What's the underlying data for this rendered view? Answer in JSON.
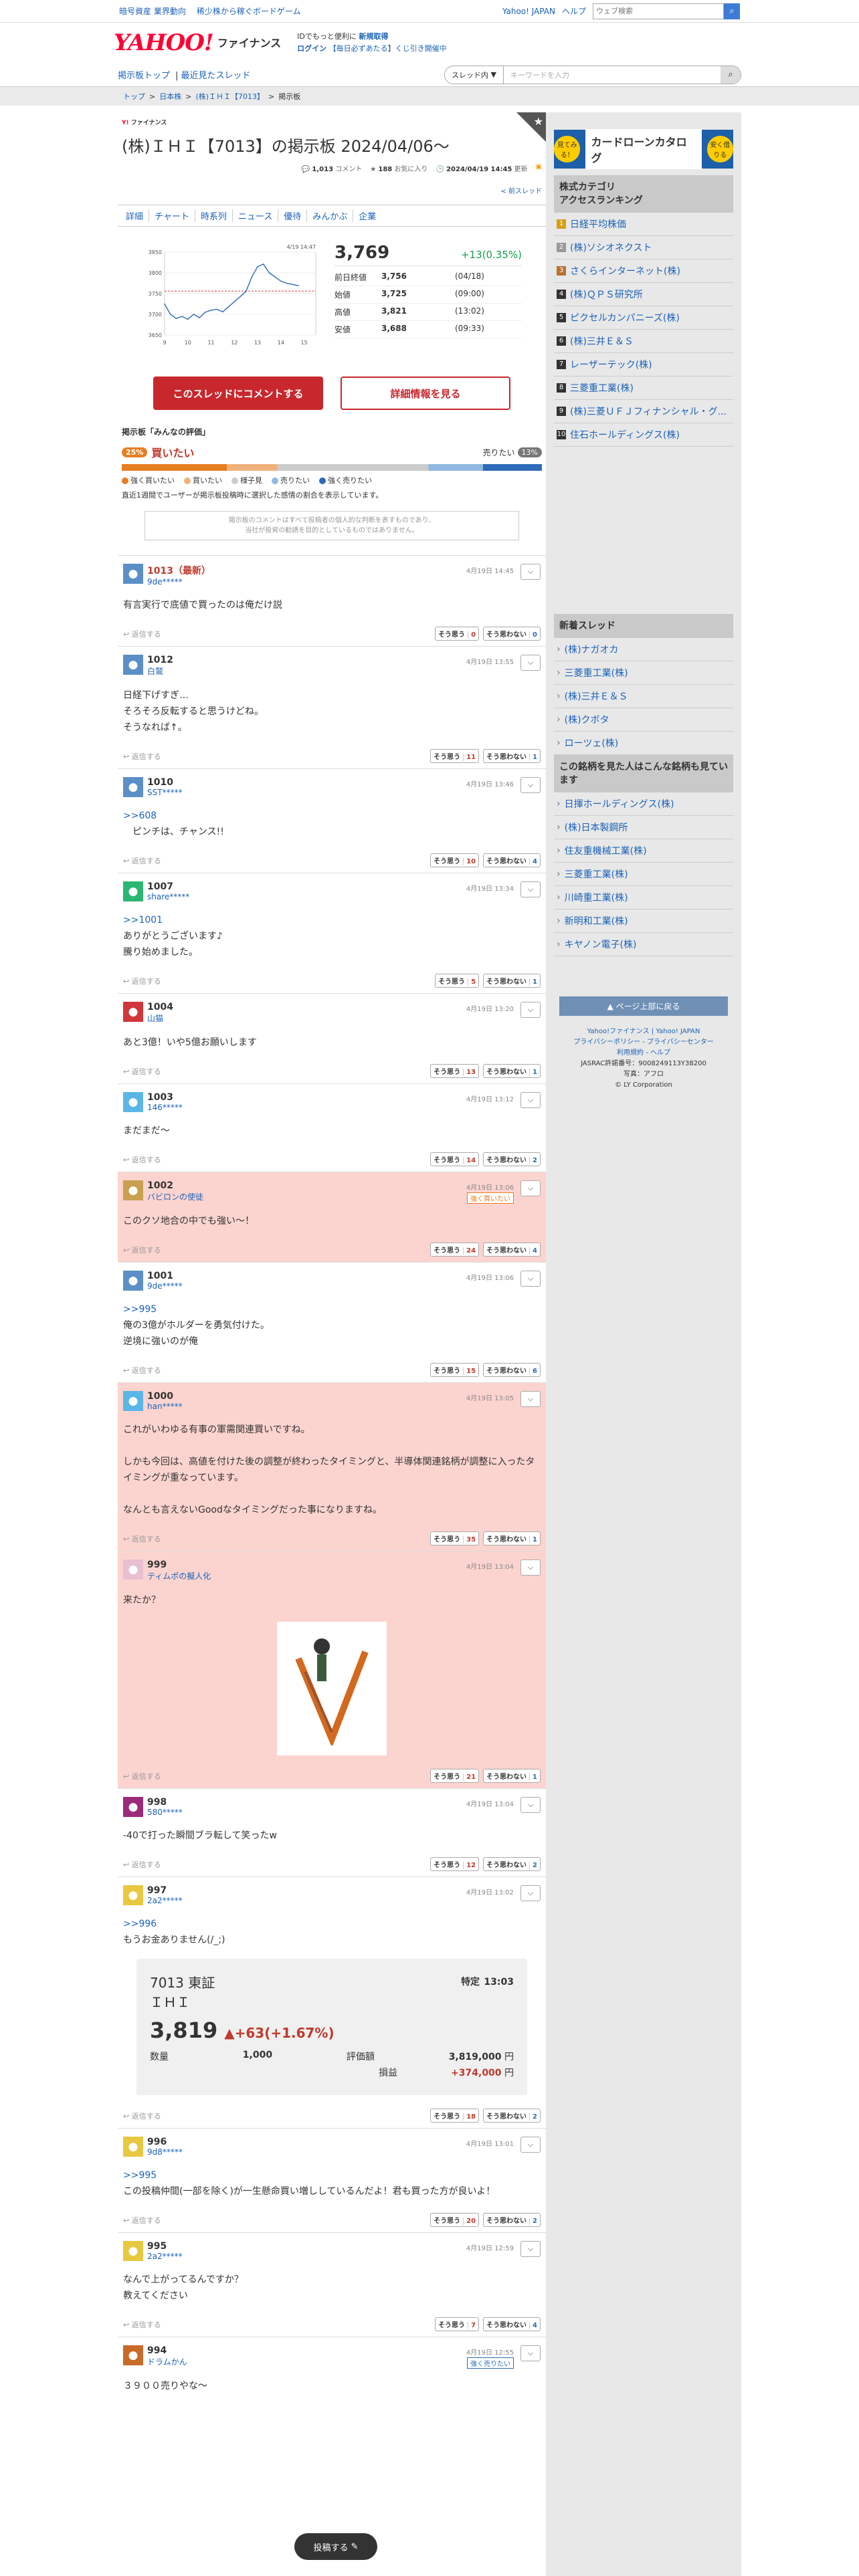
{
  "topbar": {
    "links": [
      "暗号資産 業界動向",
      "稀少株から稼ぐボードゲーム"
    ],
    "right": [
      "Yahoo! JAPAN",
      "ヘルプ"
    ],
    "search_placeholder": "ウェブ検索"
  },
  "header": {
    "logo": "YAHOO!",
    "logo_sub": "ファイナンス",
    "line1": "IDでもっと便利に",
    "line1b": "新規取得",
    "line2": "ログイン",
    "line2b": "【毎日必ずあたる】くじ引き開催中"
  },
  "nav": {
    "links": [
      "掲示板トップ",
      "最近見たスレッド"
    ],
    "select": "スレッド内",
    "placeholder": "キーワードを入力"
  },
  "crumb": [
    "トップ",
    ">",
    "日本株",
    ">",
    "(株)ＩＨＩ【7013】",
    ">",
    "掲示板"
  ],
  "title": {
    "logo_a": "Y!",
    "logo_b": "ファイナンス",
    "text": "(株)ＩＨＩ【7013】の掲示板 2024/04/06〜",
    "comments": "1,013",
    "comments_label": "コメント",
    "fav": "188",
    "fav_label": "お気に入り",
    "updated": "2024/04/19 14:45",
    "updated_label": "更新",
    "new_thread": "< 前スレッド"
  },
  "tabs": [
    "詳細",
    "チャート",
    "時系列",
    "ニュース",
    "優待",
    "みんかぶ",
    "企業"
  ],
  "chart_data": {
    "type": "line",
    "date_label": "4/19 14:47",
    "yticks": [
      3850,
      3800,
      3750,
      3700,
      3650
    ],
    "xticks": [
      "9",
      "10",
      "11",
      "12",
      "13",
      "14",
      "15"
    ],
    "ylim": [
      3650,
      3850
    ],
    "x": [
      9,
      9.25,
      9.5,
      9.75,
      10,
      10.25,
      10.5,
      10.75,
      11,
      11.25,
      11.5,
      12.5,
      12.75,
      13,
      13.25,
      13.5,
      13.75,
      14,
      14.25,
      14.5,
      14.75
    ],
    "values": [
      3725,
      3700,
      3690,
      3695,
      3688,
      3700,
      3692,
      3705,
      3710,
      3712,
      3706,
      3755,
      3790,
      3815,
      3821,
      3800,
      3790,
      3780,
      3775,
      3772,
      3769
    ],
    "ref": 3756
  },
  "quote": {
    "price": "3,769",
    "change": "+13(0.35%)",
    "rows": [
      {
        "k": "前日終値",
        "v": "3,756",
        "t": "(04/18)"
      },
      {
        "k": "始値",
        "v": "3,725",
        "t": "(09:00)"
      },
      {
        "k": "高値",
        "v": "3,821",
        "t": "(13:02)"
      },
      {
        "k": "安値",
        "v": "3,688",
        "t": "(09:33)"
      }
    ]
  },
  "buttons": {
    "comment": "このスレッドにコメントする",
    "detail": "詳細情報を見る"
  },
  "rating": {
    "heading": "掲示板「みんなの評価」",
    "buy_pct": "25%",
    "buy_label": "買いたい",
    "sell_label": "売りたい",
    "sell_pct": "13%",
    "buy_share": 25,
    "sell_share": 13,
    "legend": [
      "強く買いたい",
      "買いたい",
      "様子見",
      "売りたい",
      "強く売りたい"
    ],
    "legend_colors": [
      "#e67e22",
      "#f0b27a",
      "#cccccc",
      "#8fb9e0",
      "#2e6bb8"
    ],
    "note": "直近1週間でユーザーが掲示板投稿時に選択した感情の割合を表示しています。"
  },
  "notice": [
    "掲示板のコメントはすべて投稿者の個人的な判断を表すものであり、",
    "当社が投資の勧誘を目的としているものではありません。"
  ],
  "posts": [
    {
      "num": "1013（最新）",
      "uid": "9de*****",
      "date": "4月19日 14:45",
      "body": "有言実行で底値で買ったのは俺だけ説",
      "yes": "0",
      "no": "0",
      "color": "#5b8fc7"
    },
    {
      "num": "1012",
      "uid": "白鷲",
      "date": "4月19日 13:55",
      "body": "日経下げすぎ…\nそろそろ反転すると思うけどね。\nそうなれば↑。",
      "yes": "11",
      "no": "1",
      "color": "#5b8fc7"
    },
    {
      "num": "1010",
      "uid": "SST*****",
      "date": "4月19日 13:46",
      "reply": ">>608",
      "body": "　ピンチは、チャンス!!",
      "yes": "10",
      "no": "4",
      "color": "#5b8fc7"
    },
    {
      "num": "1007",
      "uid": "share*****",
      "date": "4月19日 13:34",
      "reply": ">>1001",
      "body": "ありがとうございます♪\n騰り始めました。",
      "yes": "5",
      "no": "1",
      "color": "#2bb673"
    },
    {
      "num": "1004",
      "uid": "山猫",
      "date": "4月19日 13:20",
      "body": "あと3億！いや5億お願いします",
      "yes": "13",
      "no": "1",
      "color": "#d0363c"
    },
    {
      "num": "1003",
      "uid": "146*****",
      "date": "4月19日 13:12",
      "body": "まだまだ〜",
      "yes": "14",
      "no": "2",
      "color": "#5bb6e8"
    },
    {
      "num": "1002",
      "uid": "バビロンの使徒",
      "date": "4月19日 13:06",
      "tag": "強く買いたい",
      "body": "このクソ地合の中でも強い〜！",
      "yes": "24",
      "no": "4",
      "color": "#c8a050",
      "pink": true
    },
    {
      "num": "1001",
      "uid": "9de*****",
      "date": "4月19日 13:06",
      "reply": ">>995",
      "body": "俺の3億がホルダーを勇気付けた。\n逆境に強いのが俺",
      "yes": "15",
      "no": "6",
      "color": "#5b8fc7"
    },
    {
      "num": "1000",
      "uid": "han*****",
      "date": "4月19日 13:05",
      "body": "これがいわゆる有事の軍需関連買いですね。\n\nしかも今回は、高値を付けた後の調整が終わったタイミングと、半導体関連銘柄が調整に入ったタイミングが重なっています。\n\nなんとも言えないGoodなタイミングだった事になりますね。",
      "yes": "35",
      "no": "1",
      "color": "#5bb6e8",
      "pink": true
    },
    {
      "num": "999",
      "uid": "ティムポの擬人化",
      "date": "4月19日 13:04",
      "body": "来たか？",
      "yes": "21",
      "no": "1",
      "color": "#e8c0d0",
      "pink": true,
      "image": true
    },
    {
      "num": "998",
      "uid": "580*****",
      "date": "4月19日 13:04",
      "body": "-40で打った瞬間ブラ転して笑ったw",
      "yes": "12",
      "no": "2",
      "color": "#9b2a7a"
    },
    {
      "num": "997",
      "uid": "2a2*****",
      "date": "4月19日 13:02",
      "reply": ">>996",
      "body": "もうお金ありません(/_;)",
      "yes": "18",
      "no": "2",
      "color": "#e8c840",
      "card": true
    },
    {
      "num": "996",
      "uid": "9d8*****",
      "date": "4月19日 13:01",
      "reply": ">>995",
      "body": "この投稿仲間(一部を除く)が一生懸命買い増ししているんだよ！君も買った方が良いよ！",
      "yes": "20",
      "no": "2",
      "color": "#e8c840"
    },
    {
      "num": "995",
      "uid": "2a2*****",
      "date": "4月19日 12:59",
      "body": "なんで上がってるんですか？\n教えてください",
      "yes": "7",
      "no": "4",
      "color": "#e8c840"
    },
    {
      "num": "994",
      "uid": "ドラムかん",
      "date": "4月19日 12:55",
      "tag": "強く売りたい",
      "tagblue": true,
      "body": "３９００売りやな〜",
      "color": "#c86a28"
    }
  ],
  "card": {
    "code": "7013 東証",
    "name": "ＩＨＩ",
    "special": "特定",
    "time": "13:03",
    "price": "3,819",
    "chg": "▲+63(+1.67%)",
    "qty_label": "数量",
    "qty": "1,000",
    "val_label": "評価額",
    "val": "3,819,000",
    "yen": "円",
    "pl_label": "損益",
    "pl": "+374,000"
  },
  "reply_label": "返信する",
  "yes_label": "そう思う",
  "no_label": "そう思わない",
  "side": {
    "ad": {
      "c1": "見てみる！",
      "title": "カードローンカタログ",
      "c2": "安く借りる"
    },
    "ranking_title": "株式カテゴリ\nアクセスランキング",
    "ranking": [
      "日経平均株価",
      "(株)ソシオネクスト",
      "さくらインターネット(株)",
      "(株)ＱＰＳ研究所",
      "ピクセルカンパニーズ(株)",
      "(株)三井Ｅ＆Ｓ",
      "レーザーテック(株)",
      "三菱重工業(株)",
      "(株)三菱ＵＦＪフィナンシャル・グ...",
      "住石ホールディングス(株)"
    ],
    "new_title": "新着スレッド",
    "new": [
      "(株)ナガオカ",
      "三菱重工業(株)",
      "(株)三井Ｅ＆Ｓ",
      "(株)クボタ",
      "ローツェ(株)"
    ],
    "also_title": "この銘柄を見た人はこんな銘柄も見ています",
    "also": [
      "日揮ホールディングス(株)",
      "(株)日本製鋼所",
      "住友重機械工業(株)",
      "三菱重工業(株)",
      "川崎重工業(株)",
      "新明和工業(株)",
      "キヤノン電子(株)"
    ],
    "top": "▲ ページ上部に戻る",
    "foot": [
      "Yahoo!ファイナンス | Yahoo! JAPAN",
      "プライバシーポリシー - プライバシーセンター",
      "利用規約 - ヘルプ",
      "JASRAC許諾番号：9008249113Y38200",
      "写真：アフロ",
      "© LY Corporation"
    ]
  },
  "float": "投稿する"
}
